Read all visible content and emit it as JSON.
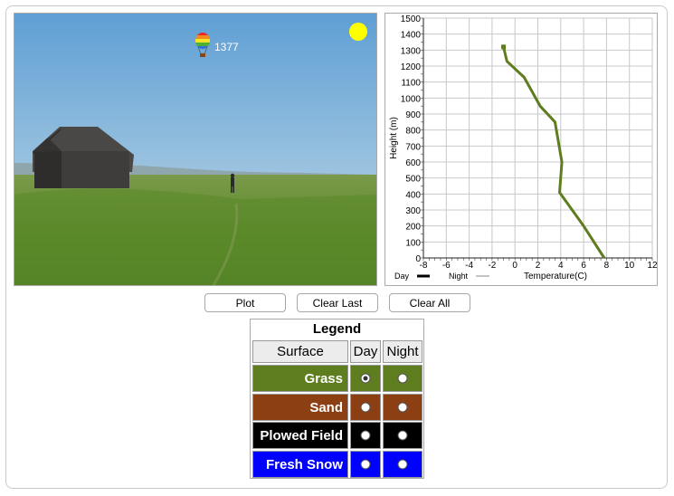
{
  "scene": {
    "balloon_altitude": "1377"
  },
  "buttons": {
    "plot": "Plot",
    "clear_last": "Clear Last",
    "clear_all": "Clear All"
  },
  "legend": {
    "title": "Legend",
    "headers": {
      "surface": "Surface",
      "day": "Day",
      "night": "Night"
    },
    "rows": [
      {
        "surface": "Grass",
        "color": "#5e7d1f",
        "day_selected": true,
        "night_selected": false
      },
      {
        "surface": "Sand",
        "color": "#8b3f13",
        "day_selected": false,
        "night_selected": false
      },
      {
        "surface": "Plowed Field",
        "color": "#000000",
        "day_selected": false,
        "night_selected": false
      },
      {
        "surface": "Fresh Snow",
        "color": "#0000ff",
        "day_selected": false,
        "night_selected": false
      }
    ]
  },
  "chart_data": {
    "type": "line",
    "xlabel": "Temperature(C)",
    "ylabel": "Height (m)",
    "xlim": [
      -8,
      12
    ],
    "ylim": [
      0,
      1500
    ],
    "x_ticks": [
      -8,
      -6,
      -4,
      -2,
      0,
      2,
      4,
      6,
      8,
      10,
      12
    ],
    "y_ticks": [
      0,
      100,
      200,
      300,
      400,
      500,
      600,
      700,
      800,
      900,
      1000,
      1100,
      1200,
      1300,
      1400,
      1500
    ],
    "grid": true,
    "legend": {
      "day_label": "Day",
      "night_label": "Night"
    },
    "series": [
      {
        "style": "day",
        "color": "#5e7d1f",
        "points": [
          [
            7.8,
            0
          ],
          [
            6.0,
            200
          ],
          [
            3.9,
            410
          ],
          [
            4.1,
            600
          ],
          [
            3.5,
            850
          ],
          [
            2.2,
            950
          ],
          [
            0.8,
            1130
          ],
          [
            -0.7,
            1230
          ],
          [
            -1.0,
            1320
          ]
        ]
      }
    ]
  }
}
